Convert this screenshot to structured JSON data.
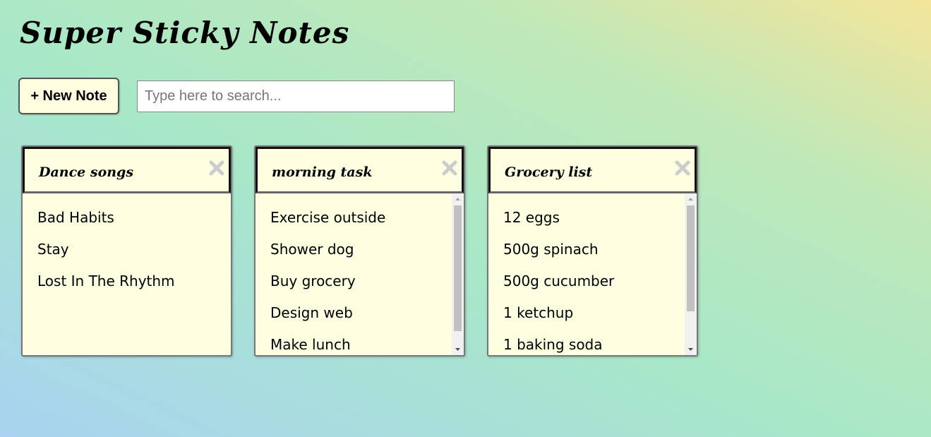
{
  "app": {
    "title": "Super Sticky Notes"
  },
  "toolbar": {
    "new_note_label": "+ New Note",
    "search_placeholder": "Type here to search...",
    "search_value": ""
  },
  "notes": [
    {
      "title": "Dance songs",
      "items": [
        "Bad Habits",
        "Stay",
        "Lost In The Rhythm"
      ],
      "scrollable": false
    },
    {
      "title": "morning task",
      "items": [
        "Exercise outside",
        "Shower dog",
        "Buy grocery",
        "Design web",
        "Make lunch"
      ],
      "scrollable": true
    },
    {
      "title": "Grocery list",
      "items": [
        "12 eggs",
        "500g spinach",
        "500g cucumber",
        "1 ketchup",
        "1 baking soda"
      ],
      "scrollable": true
    }
  ],
  "icons": {
    "close": "close-icon",
    "scroll_up": "chevron-up-icon",
    "scroll_down": "chevron-down-icon"
  },
  "colors": {
    "note_background": "#fefee0",
    "close_icon": "#cccccc",
    "gradient_start": "#a9d3f0",
    "gradient_end": "#f4e59a"
  }
}
